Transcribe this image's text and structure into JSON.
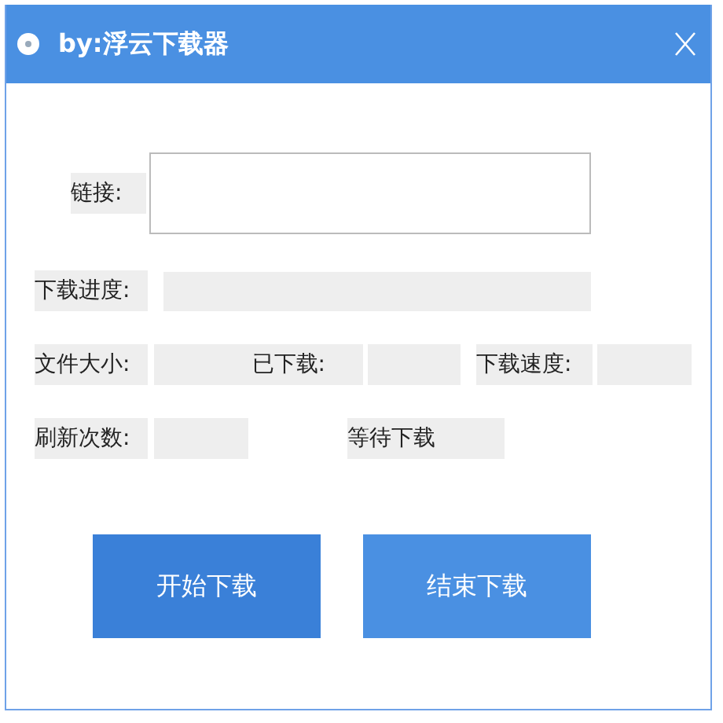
{
  "window": {
    "title": "by:浮云下载器"
  },
  "link": {
    "label": "链接:"
  },
  "progress": {
    "label": "下载进度:",
    "level": 0
  },
  "file_size": {
    "label": "文件大小:"
  },
  "downloaded": {
    "label": "已下载:"
  },
  "speed": {
    "label": "下载速度:"
  },
  "refresh_count": {
    "label": "刷新次数:"
  },
  "status": "等待下载",
  "buttons": [
    {
      "label": "开始下载",
      "kind": "primary"
    },
    {
      "label": "结束下载",
      "kind": "secondary"
    }
  ]
}
